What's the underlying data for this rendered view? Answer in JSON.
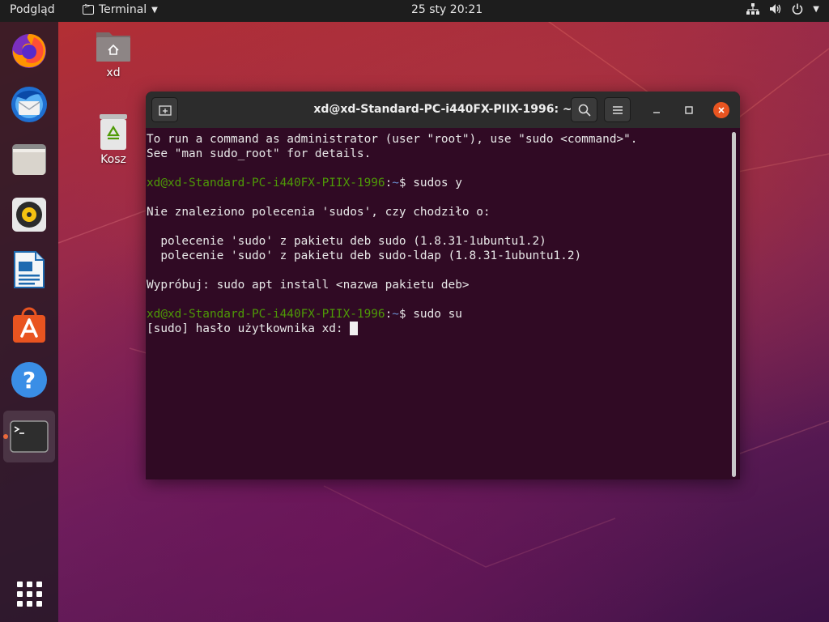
{
  "topbar": {
    "activities": "Podgląd",
    "app_name": "Terminal",
    "clock": "25 sty  20:21",
    "network_icon": "network-icon",
    "volume_icon": "volume-icon",
    "power_icon": "power-icon"
  },
  "dock": {
    "items": [
      {
        "name": "firefox-icon"
      },
      {
        "name": "thunderbird-icon"
      },
      {
        "name": "files-icon"
      },
      {
        "name": "rhythmbox-icon"
      },
      {
        "name": "writer-icon"
      },
      {
        "name": "software-icon"
      },
      {
        "name": "help-icon"
      },
      {
        "name": "terminal-icon"
      }
    ]
  },
  "desktop": {
    "home_label": "xd",
    "trash_label": "Kosz"
  },
  "window": {
    "title": "xd@xd-Standard-PC-i440FX-PIIX-1996: ~"
  },
  "terminal": {
    "lines": [
      {
        "type": "text",
        "text": "To run a command as administrator (user \"root\"), use \"sudo <command>\"."
      },
      {
        "type": "text",
        "text": "See \"man sudo_root\" for details."
      },
      {
        "type": "text",
        "text": ""
      },
      {
        "type": "prompt",
        "user": "xd@xd-Standard-PC-i440FX-PIIX-1996",
        "path": "~",
        "cmd": "sudos y"
      },
      {
        "type": "text",
        "text": ""
      },
      {
        "type": "text",
        "text": "Nie znaleziono polecenia 'sudos', czy chodziło o:"
      },
      {
        "type": "text",
        "text": ""
      },
      {
        "type": "text",
        "text": "  polecenie 'sudo' z pakietu deb sudo (1.8.31-1ubuntu1.2)"
      },
      {
        "type": "text",
        "text": "  polecenie 'sudo' z pakietu deb sudo-ldap (1.8.31-1ubuntu1.2)"
      },
      {
        "type": "text",
        "text": ""
      },
      {
        "type": "text",
        "text": "Wypróbuj: sudo apt install <nazwa pakietu deb>"
      },
      {
        "type": "text",
        "text": ""
      },
      {
        "type": "prompt",
        "user": "xd@xd-Standard-PC-i440FX-PIIX-1996",
        "path": "~",
        "cmd": "sudo su"
      },
      {
        "type": "input",
        "text": "[sudo] hasło użytkownika xd: "
      }
    ]
  },
  "colors": {
    "accent": "#e95420",
    "terminal_bg": "#300a24",
    "prompt_user": "#4e9a06",
    "prompt_path": "#6a8fd0"
  }
}
